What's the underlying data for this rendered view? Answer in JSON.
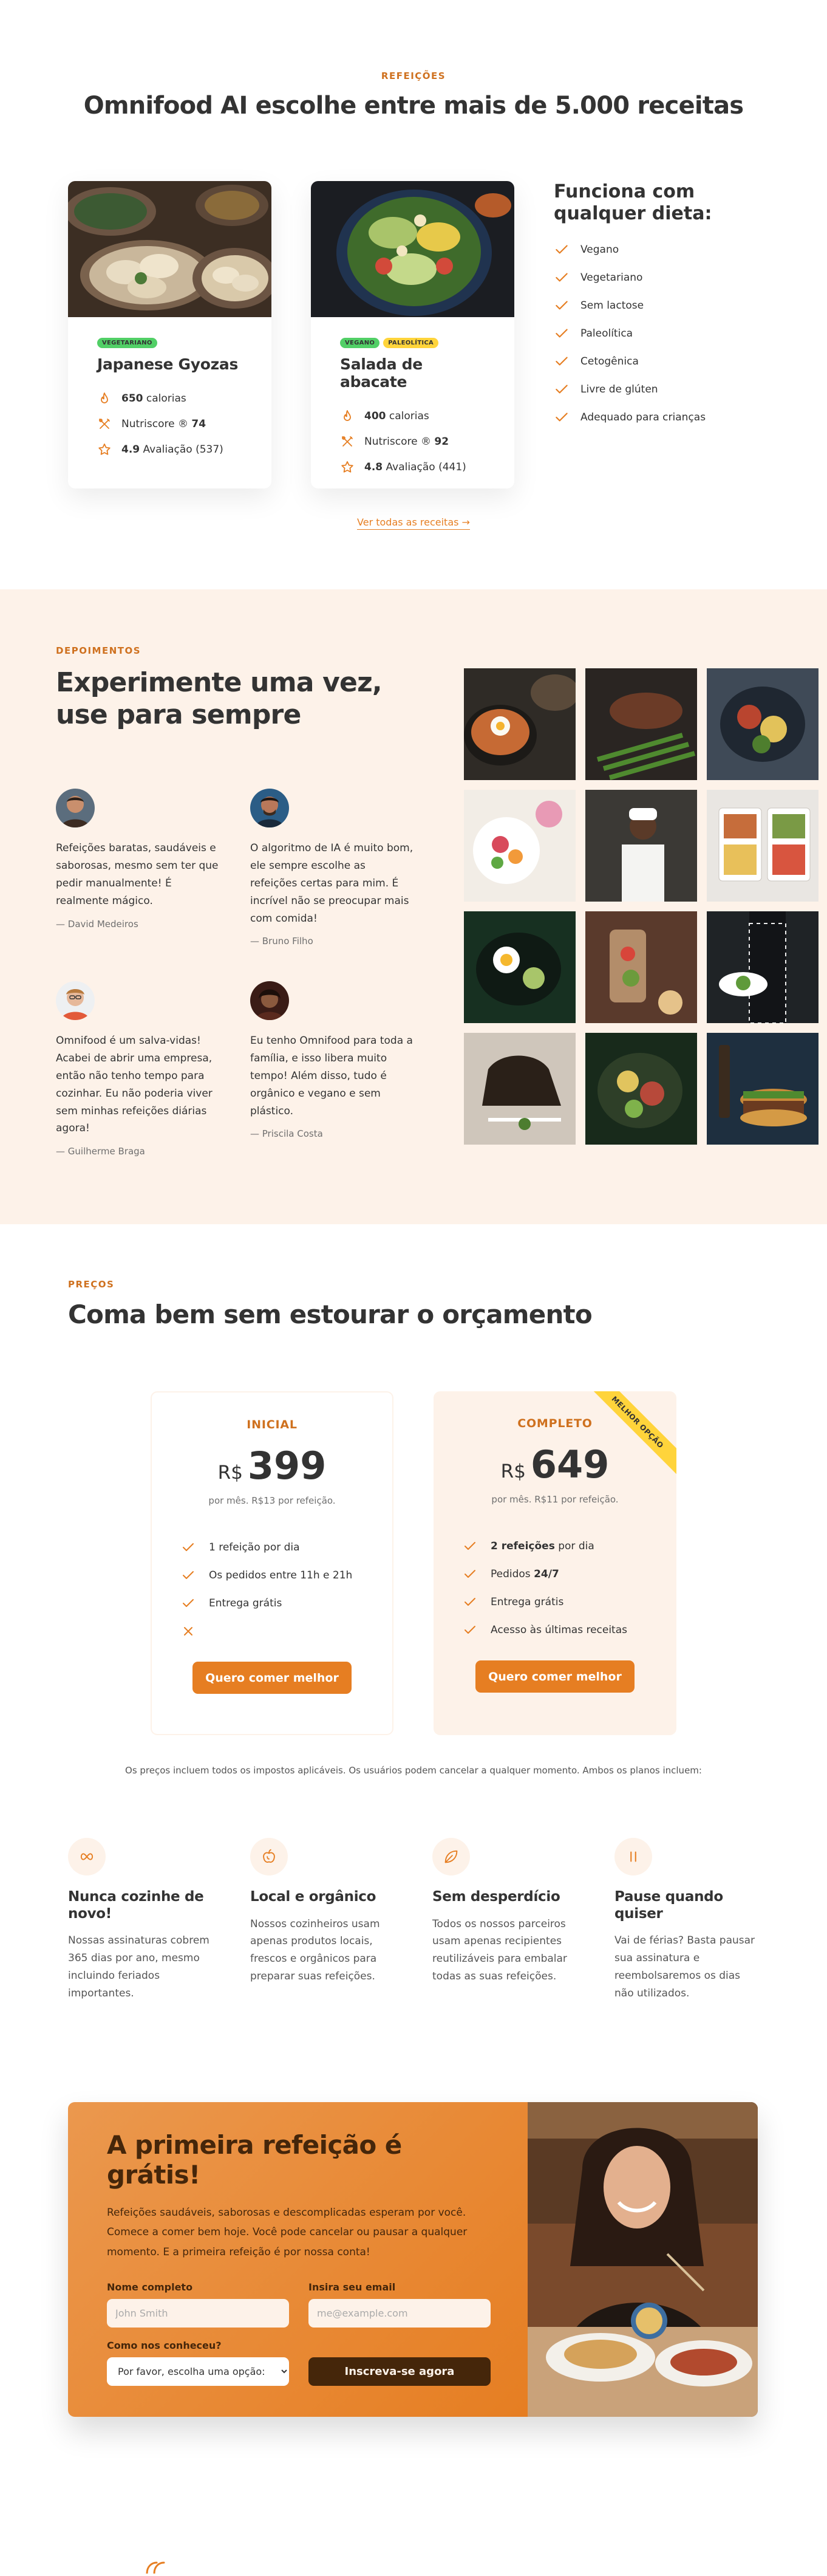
{
  "meals": {
    "subheading": "Refeições",
    "heading": "Omnifood AI escolhe entre mais de 5.000 receitas",
    "cards": [
      {
        "tags": [
          {
            "label": "Vegetariano",
            "kind": "veg"
          }
        ],
        "title": "Japanese Gyozas",
        "calories_value": "650",
        "calories_label": "calorias",
        "nutriscore_label": "Nutriscore ®",
        "nutriscore_value": "74",
        "rating_value": "4.9",
        "rating_label": "Avaliação (537)"
      },
      {
        "tags": [
          {
            "label": "Vegano",
            "kind": "veg"
          },
          {
            "label": "Paleolítica",
            "kind": "paleo"
          }
        ],
        "title": "Salada de abacate",
        "calories_value": "400",
        "calories_label": "calorias",
        "nutriscore_label": "Nutriscore ®",
        "nutriscore_value": "92",
        "rating_value": "4.8",
        "rating_label": "Avaliação (441)"
      }
    ],
    "diets_title": "Funciona com qualquer dieta:",
    "diets": [
      "Vegano",
      "Vegetariano",
      "Sem lactose",
      "Paleolítica",
      "Cetogênica",
      "Livre de glúten",
      "Adequado para crianças"
    ],
    "all_link": "Ver todas as receitas →"
  },
  "testimonials": {
    "subheading": "Depoimentos",
    "heading": "Experimente uma vez, use para sempre",
    "items": [
      {
        "text": "Refeições baratas, saudáveis e saborosas, mesmo sem ter que pedir manualmente! É realmente mágico.",
        "name": "— David Medeiros"
      },
      {
        "text": "O algoritmo de IA é muito bom, ele sempre escolhe as refeições certas para mim. É incrível não se preocupar mais com comida!",
        "name": "— Bruno Filho"
      },
      {
        "text": "Omnifood é um salva-vidas! Acabei de abrir uma empresa, então não tenho tempo para cozinhar. Eu não poderia viver sem minhas refeições diárias agora!",
        "name": "— Guilherme Braga"
      },
      {
        "text": "Eu tenho Omnifood para toda a família, e isso libera muito tempo! Além disso, tudo é orgânico e vegano e sem plástico.",
        "name": "— Priscila Costa"
      }
    ]
  },
  "pricing": {
    "subheading": "Preços",
    "heading": "Coma bem sem estourar o orçamento",
    "plans": [
      {
        "name": "Inicial",
        "currency": "R$",
        "price": "399",
        "text": "por mês. R$13 por refeição.",
        "features": [
          {
            "pre": "",
            "bold": "",
            "post": "1 refeição por dia",
            "icon": "check"
          },
          {
            "pre": "",
            "bold": "",
            "post": "Os pedidos entre 11h e 21h",
            "icon": "check"
          },
          {
            "pre": "",
            "bold": "",
            "post": "Entrega grátis",
            "icon": "check"
          },
          {
            "pre": "",
            "bold": "",
            "post": "",
            "icon": "close"
          }
        ],
        "button": "Quero comer melhor"
      },
      {
        "name": "Completo",
        "currency": "R$",
        "price": "649",
        "text": "por mês. R$11 por refeição.",
        "ribbon": "Melhor opção",
        "features": [
          {
            "pre": "",
            "bold": "2 refeições",
            "post": " por dia",
            "icon": "check"
          },
          {
            "pre": "Pedidos ",
            "bold": "24/7",
            "post": "",
            "icon": "check"
          },
          {
            "pre": "",
            "bold": "",
            "post": "Entrega grátis",
            "icon": "check"
          },
          {
            "pre": "",
            "bold": "",
            "post": "Acesso às últimas receitas",
            "icon": "check"
          }
        ],
        "button": "Quero comer melhor"
      }
    ],
    "details": "Os preços incluem todos os impostos aplicáveis. Os usuários podem cancelar a qualquer momento. Ambos os planos incluem:",
    "features": [
      {
        "icon": "infinite-icon",
        "title": "Nunca cozinhe de novo!",
        "text": "Nossas assinaturas cobrem 365 dias por ano, mesmo incluindo feriados importantes."
      },
      {
        "icon": "nutrition-icon",
        "title": "Local e orgânico",
        "text": "Nossos cozinheiros usam apenas produtos locais, frescos e orgânicos para preparar suas refeições."
      },
      {
        "icon": "leaf-icon",
        "title": "Sem desperdício",
        "text": "Todos os nossos parceiros usam apenas recipientes reutilizáveis para embalar todas as suas refeições."
      },
      {
        "icon": "pause-icon",
        "title": "Pause quando quiser",
        "text": "Vai de férias? Basta pausar sua assinatura e reembolsaremos os dias não utilizados."
      }
    ]
  },
  "cta": {
    "title": "A primeira refeição é grátis!",
    "desc": "Refeições saudáveis, saborosas e descomplicadas esperam por você. Comece a comer bem hoje. Você pode cancelar ou pausar a qualquer momento. E a primeira refeição é por nossa conta!",
    "name_label": "Nome completo",
    "name_placeholder": "John Smith",
    "email_label": "Insira seu email",
    "email_placeholder": "me@example.com",
    "source_label": "Como nos conheceu?",
    "source_selected": "Por favor, escolha uma opção:",
    "submit": "Inscreva-se agora"
  },
  "colors": {
    "primary": "#e67e22",
    "primary_dark": "#cf711f",
    "tint": "#fdf2e9",
    "cta_text": "#45260a"
  }
}
